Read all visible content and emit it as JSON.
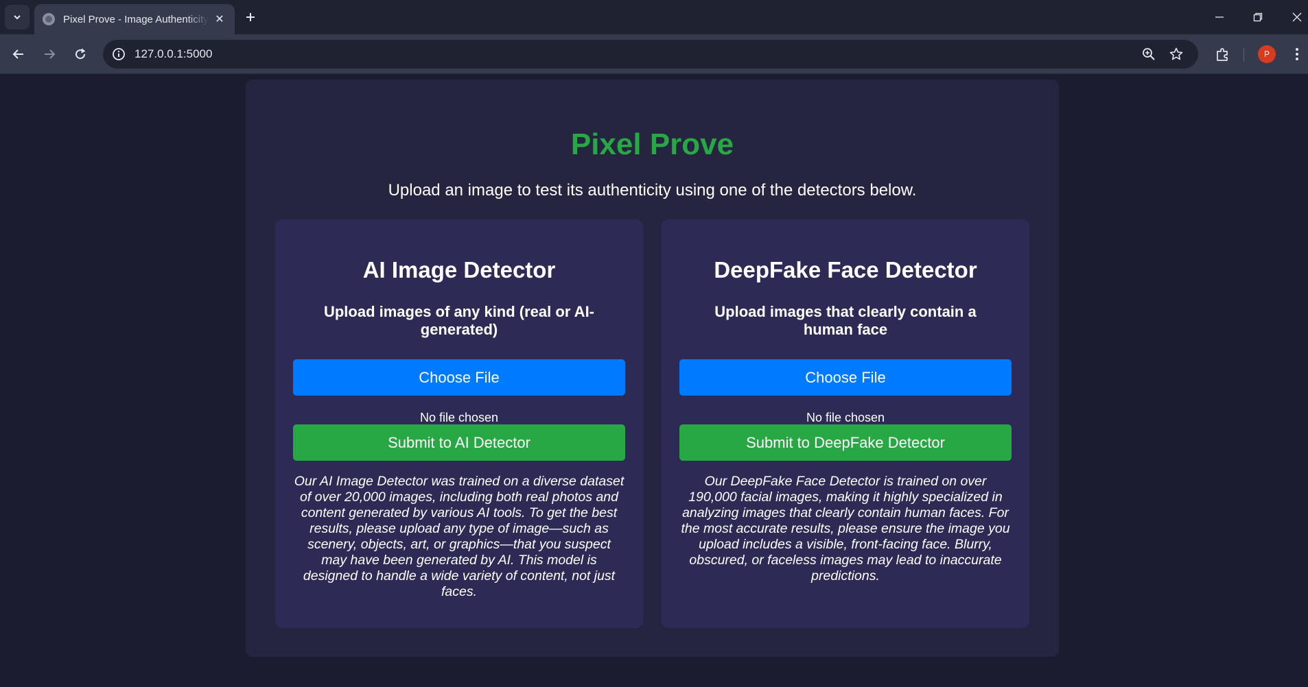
{
  "browser": {
    "tab_title": "Pixel Prove - Image Authenticity",
    "url": "127.0.0.1:5000",
    "profile_initial": "P"
  },
  "page": {
    "title": "Pixel Prove",
    "subtitle": "Upload an image to test its authenticity using one of the detectors below."
  },
  "detectors": [
    {
      "title": "AI Image Detector",
      "subtitle": "Upload images of any kind (real or AI-generated)",
      "choose_label": "Choose File",
      "file_status": "No file chosen",
      "submit_label": "Submit to AI Detector",
      "description": "Our AI Image Detector was trained on a diverse dataset of over 20,000 images, including both real photos and content generated by various AI tools. To get the best results, please upload any type of image—such as scenery, objects, art, or graphics—that you suspect may have been generated by AI. This model is designed to handle a wide variety of content, not just faces."
    },
    {
      "title": "DeepFake Face Detector",
      "subtitle": "Upload images that clearly contain a human face",
      "choose_label": "Choose File",
      "file_status": "No file chosen",
      "submit_label": "Submit to DeepFake Detector",
      "description": "Our DeepFake Face Detector is trained on over 190,000 facial images, making it highly specialized in analyzing images that clearly contain human faces. For the most accurate results, please ensure the image you upload includes a visible, front-facing face. Blurry, obscured, or faceless images may lead to inaccurate predictions."
    }
  ],
  "colors": {
    "background": "#1b1c30",
    "container": "#25253f",
    "card": "#2d2b55",
    "title_green": "#28a745",
    "primary_blue": "#007bff",
    "submit_green": "#28a745"
  }
}
